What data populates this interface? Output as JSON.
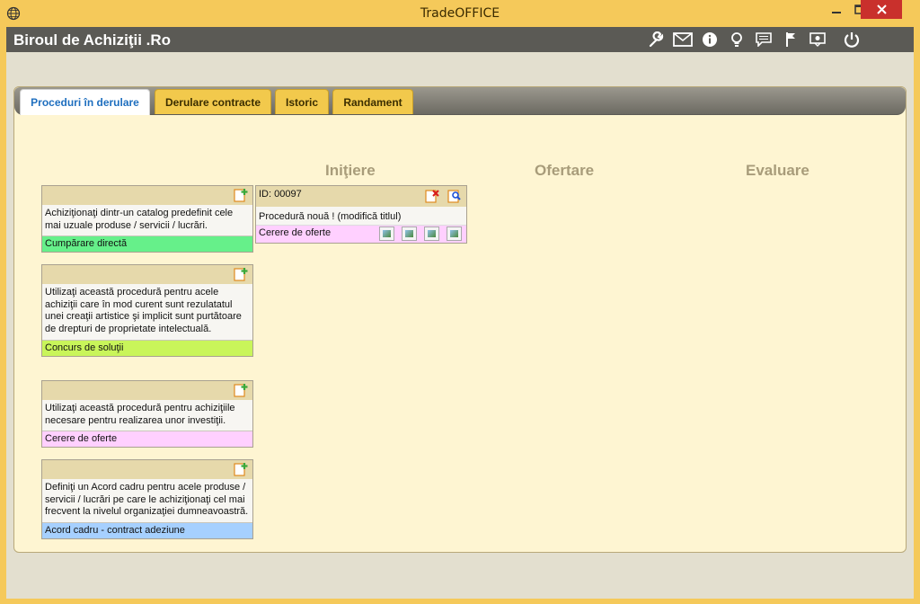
{
  "window": {
    "title": "TradeOFFICE"
  },
  "app": {
    "brand": "Biroul de Achiziţii .Ro"
  },
  "header_icons": [
    "wrench-icon",
    "mail-icon",
    "info-icon",
    "bulb-icon",
    "message-icon",
    "flag-icon",
    "feedback-icon",
    "power-icon"
  ],
  "tabs": [
    {
      "label": "Proceduri în derulare"
    },
    {
      "label": "Derulare contracte"
    },
    {
      "label": "Istoric"
    },
    {
      "label": "Randament"
    }
  ],
  "columns": {
    "initiere": "Iniţiere",
    "ofertare": "Ofertare",
    "evaluare": "Evaluare"
  },
  "templates": [
    {
      "description": "Achiziţionaţi dintr-un catalog predefinit cele mai uzuale produse / servicii / lucrări.",
      "type": "Cumpărare directă",
      "color": "#66f08a"
    },
    {
      "description": "Utilizaţi această procedură pentru acele achiziţii care în mod curent sunt rezulatatul unei creaţii artistice şi implicit sunt purtătoare de drepturi de proprietate intelectuală.",
      "type": "Concurs de soluţii",
      "color": "#c9f55a"
    },
    {
      "description": "Utilizaţi această procedură pentru achiziţiile necesare pentru realizarea unor investiţii.",
      "type": "Cerere de oferte",
      "color": "#ffd0ff"
    },
    {
      "description": "Definiţi un Acord cadru pentru acele produse / servicii / lucrări pe care le achiziţionaţi cel mai frecvent la nivelul organizaţiei dumneavoastră.",
      "type": "Acord cadru - contract adeziune",
      "color": "#a6d0ff"
    }
  ],
  "procedure": {
    "id": "ID: 00097",
    "title": "Procedură nouă ! (modifică titlul)",
    "type": "Cerere de oferte"
  }
}
